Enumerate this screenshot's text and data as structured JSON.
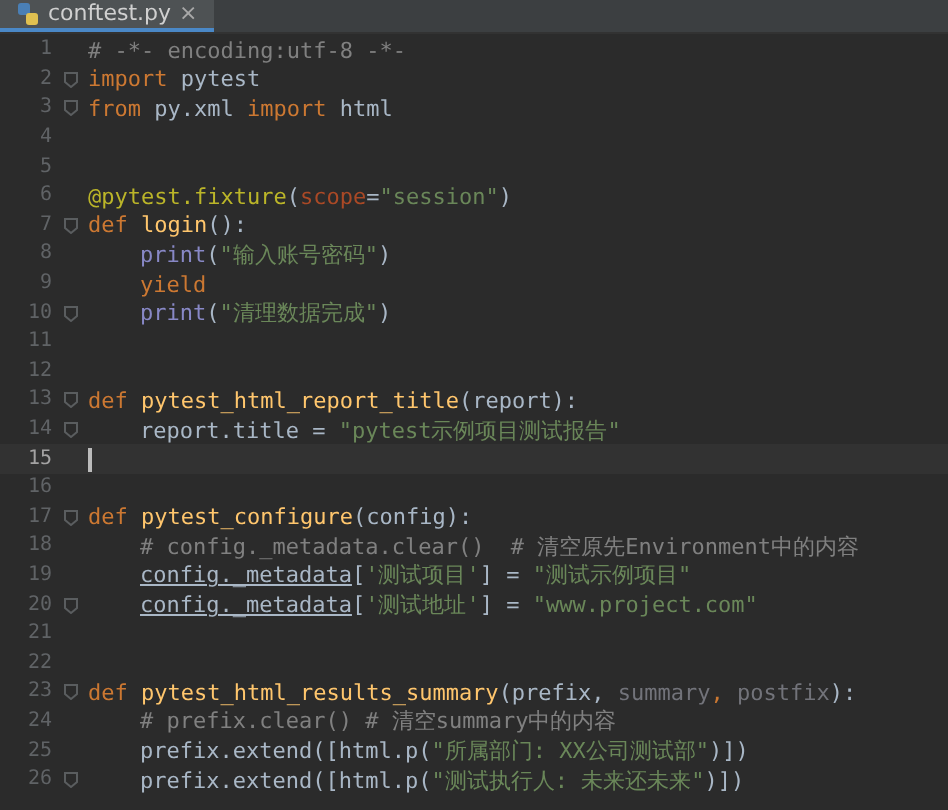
{
  "tabs": [
    {
      "label": "conftest.py",
      "close": "×",
      "selected": true
    }
  ],
  "lines": [
    {
      "number": "1",
      "fold": false,
      "current": false,
      "tokens": [
        {
          "text": "# -*- encoding:utf-8 -*-",
          "kind": "comment"
        }
      ]
    },
    {
      "number": "2",
      "fold": true,
      "current": false,
      "tokens": [
        {
          "text": "import",
          "kind": "keyword"
        },
        {
          "text": " pytest",
          "kind": "plain"
        }
      ]
    },
    {
      "number": "3",
      "fold": true,
      "current": false,
      "tokens": [
        {
          "text": "from",
          "kind": "keyword"
        },
        {
          "text": " py.xml ",
          "kind": "plain"
        },
        {
          "text": "import",
          "kind": "keyword"
        },
        {
          "text": " html",
          "kind": "plain"
        }
      ]
    },
    {
      "number": "4",
      "fold": false,
      "current": false
    },
    {
      "number": "5",
      "fold": false,
      "current": false
    },
    {
      "number": "6",
      "fold": false,
      "current": false,
      "tokens": [
        {
          "text": "@pytest.fixture",
          "kind": "decorator"
        },
        {
          "text": "(",
          "kind": "plain"
        },
        {
          "text": "scope",
          "kind": "param"
        },
        {
          "text": "=",
          "kind": "plain"
        },
        {
          "text": "\"session\"",
          "kind": "string"
        },
        {
          "text": ")",
          "kind": "plain"
        }
      ]
    },
    {
      "number": "7",
      "fold": true,
      "current": false,
      "tokens": [
        {
          "text": "def",
          "kind": "keyword"
        },
        {
          "text": " login",
          "kind": "function"
        },
        {
          "text": "():",
          "kind": "plain"
        }
      ],
      "children": [
        {
          "number": "8",
          "fold": false,
          "current": false,
          "tokens": [
            {
              "text": "print",
              "kind": "builtin"
            },
            {
              "text": "(",
              "kind": "plain"
            },
            {
              "text": "\"输入账号密码\"",
              "kind": "string"
            },
            {
              "text": ")",
              "kind": "plain"
            }
          ]
        },
        {
          "number": "9",
          "fold": false,
          "current": false,
          "tokens": [
            {
              "text": "yield",
              "kind": "keyword"
            }
          ]
        },
        {
          "number": "10",
          "fold": true,
          "current": false,
          "tokens": [
            {
              "text": "print",
              "kind": "builtin"
            },
            {
              "text": "(",
              "kind": "plain"
            },
            {
              "text": "\"清理数据完成\"",
              "kind": "string"
            },
            {
              "text": ")",
              "kind": "plain"
            }
          ]
        }
      ]
    },
    {
      "number": "11",
      "fold": false,
      "current": false
    },
    {
      "number": "12",
      "fold": false,
      "current": false
    },
    {
      "number": "13",
      "fold": true,
      "current": false,
      "tokens": [
        {
          "text": "def",
          "kind": "keyword"
        },
        {
          "text": " pytest_html_report_title",
          "kind": "function"
        },
        {
          "text": "(report):",
          "kind": "plain"
        }
      ],
      "children": [
        {
          "number": "14",
          "fold": true,
          "current": false,
          "tokens": [
            {
              "text": "report.title = ",
              "kind": "plain"
            },
            {
              "text": "\"pytest示例项目测试报告\"",
              "kind": "string"
            }
          ]
        }
      ]
    },
    {
      "number": "15",
      "fold": false,
      "current": true
    },
    {
      "number": "16",
      "fold": false,
      "current": false
    },
    {
      "number": "17",
      "fold": true,
      "current": false,
      "tokens": [
        {
          "text": "def",
          "kind": "keyword"
        },
        {
          "text": " pytest_configure",
          "kind": "function"
        },
        {
          "text": "(config):",
          "kind": "plain"
        }
      ],
      "children": [
        {
          "number": "18",
          "fold": false,
          "current": false,
          "tokens": [
            {
              "text": "# config._metadata.clear()  # 清空原先Environment中的内容",
              "kind": "comment"
            }
          ]
        },
        {
          "number": "19",
          "fold": false,
          "current": false,
          "tokens": [
            {
              "text": "config._metadata",
              "kind": "reference"
            },
            {
              "text": "[",
              "kind": "plain"
            },
            {
              "text": "'测试项目'",
              "kind": "string"
            },
            {
              "text": "] = ",
              "kind": "plain"
            },
            {
              "text": "\"测试示例项目\"",
              "kind": "string"
            }
          ]
        },
        {
          "number": "20",
          "fold": true,
          "current": false,
          "tokens": [
            {
              "text": "config._metadata",
              "kind": "reference"
            },
            {
              "text": "[",
              "kind": "plain"
            },
            {
              "text": "'测试地址'",
              "kind": "string"
            },
            {
              "text": "] = ",
              "kind": "plain"
            },
            {
              "text": "\"www.project.com\"",
              "kind": "string"
            }
          ]
        }
      ]
    },
    {
      "number": "21",
      "fold": false,
      "current": false
    },
    {
      "number": "22",
      "fold": false,
      "current": false
    },
    {
      "number": "23",
      "fold": true,
      "current": false,
      "tokens": [
        {
          "text": "def",
          "kind": "keyword"
        },
        {
          "text": " pytest_html_results_summary",
          "kind": "function"
        },
        {
          "text": "(prefix, ",
          "kind": "plain"
        },
        {
          "text": "summary",
          "kind": "unused"
        },
        {
          "text": ", ",
          "kind": "keyword"
        },
        {
          "text": "postfix",
          "kind": "unused"
        },
        {
          "text": "):",
          "kind": "plain"
        }
      ],
      "children": [
        {
          "number": "24",
          "fold": false,
          "current": false,
          "tokens": [
            {
              "text": "# prefix.clear() # 清空summary中的内容",
              "kind": "comment"
            }
          ]
        },
        {
          "number": "25",
          "fold": false,
          "current": false,
          "tokens": [
            {
              "text": "prefix.extend([html.p(",
              "kind": "plain"
            },
            {
              "text": "\"所属部门: XX公司测试部\"",
              "kind": "string"
            },
            {
              "text": ")])",
              "kind": "plain"
            }
          ]
        },
        {
          "number": "26",
          "fold": true,
          "current": false,
          "tokens": [
            {
              "text": "prefix.extend([html.p(",
              "kind": "plain"
            },
            {
              "text": "\"测试执行人: 未来还未来\"",
              "kind": "string"
            },
            {
              "text": ")])",
              "kind": "plain"
            }
          ]
        }
      ]
    }
  ]
}
